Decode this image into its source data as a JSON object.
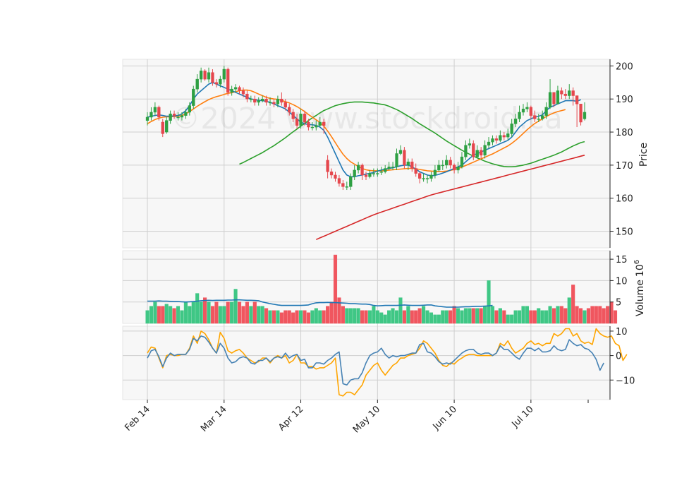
{
  "watermark": "©2024 www.stockdroid.ca",
  "colors": {
    "up": "#26a269",
    "up_candle": "#2ea043",
    "down": "#e5474d",
    "vol_up": "#3fc785",
    "vol_down": "#f0565f",
    "ma_fast": "#1f77b4",
    "ma_mid": "#ff7f0e",
    "ma_slow": "#2ca02c",
    "ma_long": "#d62728",
    "osc_fast": "#4682b4",
    "osc_slow": "#ffa500",
    "panel_bg": "#f7f7f7",
    "grid": "#cfcfcf"
  },
  "chart_data": {
    "type": "candlestick",
    "x_tick_labels": [
      "Feb 14",
      "Mar 14",
      "Apr 12",
      "May 10",
      "Jun 10",
      "Jul 10"
    ],
    "x_tick_index": [
      0,
      20,
      40,
      60,
      80,
      100
    ],
    "price_panel": {
      "ylabel": "Price",
      "ylim": [
        145,
        202
      ],
      "yticks": [
        150,
        160,
        170,
        180,
        190,
        200
      ],
      "close": [
        184.5,
        186,
        187.5,
        184.5,
        179.5,
        183.5,
        185.5,
        185,
        184.5,
        185,
        186,
        188,
        193,
        196,
        198.5,
        196,
        198,
        195,
        194.5,
        196,
        199,
        192,
        193,
        193.5,
        192.5,
        191.5,
        190,
        190,
        189,
        189.5,
        190,
        189,
        189,
        188.5,
        190,
        189,
        187.5,
        186,
        184,
        182,
        185.5,
        183,
        181.5,
        181.5,
        182,
        183,
        182,
        168,
        167,
        166,
        164.5,
        163.5,
        163.5,
        166.5,
        168.5,
        170,
        167,
        166.5,
        167.5,
        167.5,
        167.5,
        168,
        169,
        169.5,
        169.5,
        173.5,
        174.5,
        170,
        171,
        169,
        167.5,
        166,
        166,
        166,
        167,
        168.5,
        170,
        170,
        171.5,
        170,
        168.5,
        169.5,
        172.5,
        176,
        176.5,
        172.5,
        174.5,
        173,
        176,
        177,
        178,
        177.5,
        179,
        178.5,
        179.5,
        182.5,
        184,
        186,
        187,
        187.5,
        185,
        184,
        184,
        185,
        187.5,
        192,
        188.5,
        192.5,
        191.5,
        191,
        192.5,
        191,
        188.5,
        183,
        186
      ],
      "open": [
        183.5,
        184.5,
        186,
        187.5,
        183,
        180,
        183.5,
        185.5,
        184.5,
        184.5,
        185,
        186,
        188,
        193,
        196,
        198.5,
        196,
        198,
        195,
        194.5,
        196,
        199,
        192,
        193,
        193.5,
        192.5,
        191.5,
        190,
        190,
        189,
        189.5,
        190,
        189,
        189,
        188.5,
        190,
        189,
        187.5,
        186,
        184,
        182,
        185.5,
        183,
        181.5,
        181.5,
        182,
        183,
        171.5,
        168,
        167,
        166,
        164.5,
        163.5,
        163.5,
        166.5,
        168.5,
        170,
        167,
        166.5,
        167.5,
        167.5,
        168,
        168,
        169,
        169.5,
        169.5,
        173.5,
        174.5,
        170,
        171,
        169,
        167.5,
        166,
        166,
        166,
        167,
        168.5,
        170,
        170,
        171.5,
        170,
        168.5,
        169.5,
        172.5,
        176,
        176.5,
        172.5,
        174.5,
        173,
        176,
        177,
        178,
        177.5,
        179,
        178.5,
        179.5,
        182.5,
        184,
        186,
        187,
        187.5,
        185,
        184,
        184,
        185,
        187.5,
        192,
        188.5,
        192.5,
        191.5,
        191,
        192.5,
        191,
        188.5,
        184
      ],
      "high": [
        186,
        187.5,
        189,
        188,
        184,
        184.5,
        186.5,
        186.5,
        186,
        186,
        187,
        189,
        194,
        197.5,
        199.5,
        199,
        199.5,
        199,
        196,
        197,
        200,
        199.5,
        194,
        194.5,
        194,
        193.5,
        192.5,
        191,
        191,
        190.5,
        191,
        191,
        190.5,
        190,
        191,
        192,
        190,
        188.5,
        187,
        185.5,
        187,
        186.5,
        184,
        183,
        183.5,
        184.5,
        184,
        173,
        169,
        168,
        167,
        165.5,
        165,
        167.5,
        170,
        171,
        170.5,
        168,
        168.5,
        169,
        169,
        169.5,
        170,
        171,
        171,
        175,
        176,
        175.5,
        172,
        172,
        170.5,
        168,
        167.5,
        167,
        168,
        170,
        171.5,
        171.5,
        173,
        172.5,
        170.5,
        171,
        174,
        177.5,
        178,
        177.5,
        176,
        175.5,
        177.5,
        178.5,
        179,
        179,
        180.5,
        180,
        181,
        184,
        185.5,
        188,
        188.5,
        189,
        188,
        186.5,
        185.5,
        186.5,
        189,
        196,
        192,
        194,
        193.5,
        193,
        194.5,
        193.5,
        190,
        186,
        189
      ],
      "low": [
        182,
        183.5,
        185,
        183.5,
        178.5,
        179.5,
        182.5,
        184,
        183.5,
        183.5,
        184,
        185,
        187,
        192,
        195,
        195.5,
        195,
        194,
        193.5,
        193.5,
        195,
        191,
        191,
        192,
        191.5,
        190.5,
        189,
        189,
        188,
        188,
        189,
        188,
        188,
        187.5,
        187.5,
        188,
        186.5,
        185,
        183,
        181,
        181,
        182,
        180.5,
        180.5,
        180.5,
        181.5,
        179.5,
        166,
        166,
        165,
        163.5,
        162.5,
        162.5,
        162.5,
        165.5,
        167.5,
        165.5,
        165.5,
        166,
        166.5,
        166.5,
        167,
        167.5,
        168.5,
        168.5,
        168.5,
        173,
        169,
        168.5,
        168,
        166.5,
        164.5,
        165,
        164.5,
        165,
        166,
        168,
        168.5,
        169,
        169,
        167.5,
        167.5,
        169,
        171.5,
        175,
        171.5,
        172,
        172,
        172,
        175,
        176,
        176.5,
        177,
        177.5,
        177.5,
        178.5,
        181.5,
        183,
        185,
        186,
        184,
        183,
        183,
        183.5,
        184,
        187,
        187.5,
        189,
        190,
        190,
        190,
        188,
        181.5,
        182,
        183.5
      ],
      "ma_fast": [
        184.5,
        184.8,
        185,
        185.2,
        185,
        184.8,
        184.8,
        184.9,
        185,
        185.5,
        186.5,
        188,
        190,
        191.5,
        192.5,
        193.5,
        194.5,
        195,
        194.5,
        194,
        193.5,
        193,
        192.5,
        192,
        191.5,
        191,
        190.5,
        190,
        189.8,
        189.6,
        189.5,
        189.3,
        189,
        188.5,
        188,
        187.5,
        187,
        186,
        185,
        184,
        183,
        182.5,
        182.3,
        182.2,
        182,
        181.5,
        180.5,
        178.5,
        176,
        173.5,
        171,
        168.5,
        167,
        166.5,
        166.5,
        166.8,
        167,
        167.3,
        167.5,
        167.8,
        168.2,
        168.5,
        168.8,
        169,
        169.2,
        169.5,
        169.8,
        170,
        170,
        169.5,
        168.8,
        168,
        167.5,
        167,
        166.8,
        166.9,
        167.2,
        167.6,
        168,
        168.5,
        169,
        169.5,
        170,
        171,
        172,
        173,
        173.5,
        174,
        174.5,
        175,
        175.5,
        176,
        176.5,
        177,
        177.5,
        178.5,
        180,
        181.5,
        182.5,
        183.5,
        184,
        184.5,
        184.8,
        185.2,
        186.5,
        187.5,
        188,
        188.5,
        189,
        189.5,
        189.5,
        189.5,
        189.3,
        189.8
      ],
      "ma_mid": [
        182.5,
        183.2,
        183.8,
        184.2,
        184.5,
        184.6,
        184.6,
        184.7,
        184.8,
        185,
        185.5,
        186.2,
        187,
        187.8,
        188.5,
        189.2,
        189.8,
        190.3,
        190.7,
        191,
        191.4,
        191.7,
        191.9,
        192.2,
        192.5,
        192.7,
        192.7,
        192.5,
        192,
        191.5,
        191,
        190.5,
        190.2,
        190,
        189.9,
        189.6,
        189.2,
        188.8,
        188.3,
        187.7,
        187,
        186.2,
        185.3,
        184.5,
        183.7,
        182.9,
        181.8,
        180.3,
        178.6,
        176.8,
        175,
        173.3,
        172,
        171,
        170.3,
        169.6,
        169,
        168.6,
        168.4,
        168.3,
        168.3,
        168.3,
        168.4,
        168.5,
        168.6,
        168.7,
        168.8,
        168.9,
        169,
        169,
        168.9,
        168.7,
        168.5,
        168.3,
        168.2,
        168.1,
        168.1,
        168.1,
        168.2,
        168.4,
        168.7,
        169,
        169.4,
        169.9,
        170.4,
        170.9,
        171.4,
        171.9,
        172.4,
        172.9,
        173.4,
        174,
        174.6,
        175.2,
        175.8,
        176.6,
        177.5,
        178.5,
        179.6,
        180.7,
        181.7,
        182.6,
        183.3,
        184,
        184.7,
        185.3,
        185.8,
        186.2,
        186.5,
        186.8
      ],
      "ma_slow": [
        170.3,
        170.8,
        171.4,
        172,
        172.6,
        173.2,
        173.8,
        174.5,
        175.2,
        175.9,
        176.7,
        177.5,
        178.3,
        179.2,
        180.1,
        180.9,
        181.8,
        182.6,
        183.5,
        184.3,
        185,
        185.8,
        186.5,
        187,
        187.5,
        188,
        188.3,
        188.6,
        188.8,
        189,
        189.1,
        189.1,
        189.1,
        189,
        188.9,
        188.8,
        188.6,
        188.4,
        188.2,
        187.8,
        187.3,
        186.8,
        186.2,
        185.5,
        184.8,
        184.1,
        183.3,
        182.5,
        181.8,
        181.1,
        180.4,
        179.7,
        178.9,
        178.1,
        177.3,
        176.6,
        175.9,
        175.2,
        174.5,
        173.9,
        173.3,
        172.7,
        172.2,
        171.7,
        171.2,
        170.8,
        170.4,
        170.1,
        169.8,
        169.6,
        169.5,
        169.5,
        169.6,
        169.8,
        170,
        170.3,
        170.6,
        171,
        171.4,
        171.8,
        172.2,
        172.6,
        173,
        173.5,
        174,
        174.6,
        175.2,
        175.8,
        176.3,
        176.8,
        177.1
      ],
      "ma_long": [
        147.5,
        148,
        148.5,
        149,
        149.5,
        150,
        150.5,
        151,
        151.5,
        152,
        152.5,
        153,
        153.5,
        154,
        154.5,
        155,
        155.4,
        155.8,
        156.2,
        156.6,
        157,
        157.4,
        157.8,
        158.2,
        158.6,
        159,
        159.4,
        159.8,
        160.2,
        160.6,
        161,
        161.3,
        161.6,
        161.9,
        162.2,
        162.5,
        162.8,
        163.1,
        163.4,
        163.7,
        164,
        164.3,
        164.6,
        164.9,
        165.2,
        165.5,
        165.8,
        166.1,
        166.4,
        166.7,
        167,
        167.3,
        167.6,
        167.9,
        168.2,
        168.5,
        168.8,
        169.1,
        169.4,
        169.7,
        170,
        170.3,
        170.6,
        170.9,
        171.2,
        171.5,
        171.8,
        172.1,
        172.4,
        172.7,
        173
      ]
    },
    "volume_panel": {
      "ylabel": "Volume",
      "multiplier": "10",
      "multiplier_exp": "6",
      "ylim": [
        0,
        17
      ],
      "yticks": [
        5,
        10,
        15
      ],
      "values": [
        3,
        4,
        5,
        4,
        4,
        4.5,
        4,
        3.5,
        4,
        3,
        5,
        4,
        5,
        7,
        5,
        6,
        5,
        4,
        5,
        4,
        4,
        5,
        5,
        8,
        5,
        4,
        5,
        4,
        5,
        4,
        4,
        3.5,
        3,
        3,
        3,
        2.5,
        3,
        3,
        2.5,
        3,
        3,
        3,
        2.5,
        3,
        3.5,
        3,
        3,
        4,
        5,
        16,
        6,
        4,
        3.5,
        3.5,
        3.5,
        3.5,
        3,
        3,
        3,
        4,
        3,
        2.5,
        2,
        3,
        3.5,
        3,
        6,
        3,
        4,
        3,
        3,
        3.5,
        4,
        3,
        2.5,
        2,
        2,
        3,
        3,
        3,
        4,
        3.5,
        3,
        3.5,
        3.5,
        3.5,
        3.5,
        3.5,
        4,
        10,
        4,
        3,
        3.5,
        3,
        2,
        2,
        3,
        3,
        4,
        4,
        3,
        3,
        3.5,
        3,
        3,
        4,
        3.5,
        4,
        4,
        3.5,
        6,
        9,
        4,
        3.5,
        3,
        3.5,
        4,
        4,
        4,
        3.5,
        4,
        5,
        3
      ],
      "ma": [
        5.2,
        5.2,
        5.2,
        5.25,
        5.2,
        5.2,
        5.15,
        5.1,
        5.1,
        5.05,
        5,
        5.05,
        5.1,
        5.2,
        5.3,
        5.35,
        5.4,
        5.35,
        5.4,
        5.4,
        5.4,
        5.45,
        5.45,
        5.5,
        5.5,
        5.45,
        5.4,
        5.4,
        5.35,
        5.3,
        5,
        4.8,
        4.6,
        4.45,
        4.3,
        4.2,
        4.2,
        4.2,
        4.2,
        4.2,
        4.2,
        4.25,
        4.3,
        4.6,
        4.8,
        4.85,
        4.85,
        4.9,
        4.85,
        4.85,
        4.8,
        4.75,
        4.7,
        4.6,
        4.6,
        4.55,
        4.5,
        4.5,
        4.4,
        4.2,
        4.1,
        4.15,
        4.2,
        4.2,
        4.2,
        4.2,
        4.25,
        4.3,
        4.25,
        4.2,
        4.2,
        4.2,
        4.25,
        4.3,
        4.3,
        4.1,
        4,
        3.9,
        3.8,
        3.8,
        3.8,
        3.8,
        3.85,
        3.9,
        3.9,
        3.95,
        4,
        4,
        4.05,
        4.1,
        4.2
      ]
    },
    "oscillator_panel": {
      "ylim": [
        -18,
        12
      ],
      "yticks": [
        10,
        0,
        -10
      ],
      "fast": [
        -1,
        2,
        2.5,
        -0.5,
        -4.5,
        -1,
        1,
        0,
        0.5,
        0.5,
        0.5,
        2.5,
        7,
        6,
        8,
        7.5,
        5.5,
        3,
        1,
        5,
        3,
        -1,
        -3,
        -2.5,
        -1,
        -0.5,
        -1,
        -3,
        -3.5,
        -2,
        -2,
        -1,
        -2.5,
        -1,
        -0.5,
        -1,
        1,
        -1,
        0,
        0.5,
        -2,
        -1.5,
        -5,
        -5,
        -3,
        -3,
        -3.5,
        -2,
        -1,
        0.5,
        1.5,
        -11.5,
        -12,
        -10,
        -9.5,
        -9.5,
        -7,
        -3,
        0,
        1,
        1.5,
        3,
        0.5,
        -1,
        0,
        -0.5,
        0,
        0,
        0.5,
        1,
        1,
        4.5,
        5,
        1.5,
        1,
        -0.5,
        -2.5,
        -3.5,
        -3,
        -3.5,
        -2,
        -0.5,
        1,
        2,
        2.5,
        2.5,
        1,
        0.5,
        1,
        1,
        0,
        1,
        4,
        2.5,
        2.5,
        1,
        -0.5,
        -1.5,
        1,
        3,
        3,
        2,
        3,
        1.5,
        1.5,
        2,
        4,
        2.5,
        2,
        2.5,
        6.5,
        5,
        4,
        4.5,
        3,
        2.5,
        1,
        -1.5,
        -6,
        -3
      ],
      "slow": [
        1,
        3.5,
        3,
        -1,
        -5,
        0,
        0.5,
        0,
        0,
        0.5,
        0.5,
        3,
        8,
        5,
        10,
        9,
        6.5,
        3,
        1,
        9.5,
        7,
        2,
        1,
        2,
        2.5,
        1,
        -1,
        -2,
        -3,
        -2.5,
        -1,
        -1,
        -3,
        -1,
        0,
        -1,
        0,
        -3,
        -2,
        0.5,
        -3,
        -3,
        -4.5,
        -4.5,
        -5.5,
        -5,
        -5,
        -4,
        -3,
        -1,
        -16,
        -16.5,
        -15,
        -15,
        -16,
        -14,
        -12,
        -8,
        -6,
        -4,
        -3,
        -6,
        -8,
        -6,
        -4,
        -3,
        -1,
        -1,
        0,
        0.5,
        1,
        3,
        6,
        5,
        3,
        1,
        -2,
        -4,
        -4.5,
        -3,
        -3.5,
        -2,
        -1,
        0,
        0.5,
        0.5,
        0,
        0,
        0,
        0,
        0,
        1,
        5,
        4,
        6,
        3,
        1,
        2,
        3,
        5,
        6,
        4.5,
        5,
        4,
        5,
        5,
        9,
        8,
        9,
        11,
        11,
        8,
        9,
        6,
        5,
        5.5,
        4.5,
        11,
        9,
        8,
        7.5,
        8,
        5,
        4,
        -2,
        0.5
      ]
    }
  }
}
